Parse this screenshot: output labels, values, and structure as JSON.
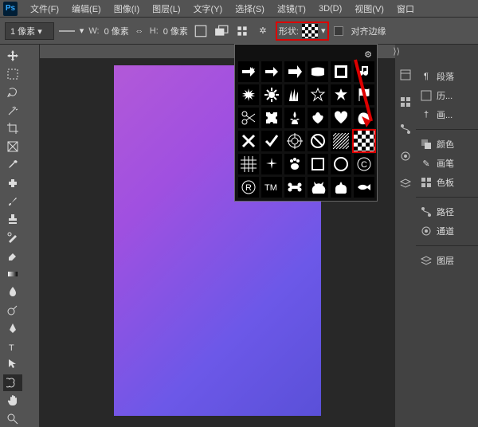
{
  "app": {
    "logo": "Ps"
  },
  "menu": {
    "file": "文件(F)",
    "edit": "编辑(E)",
    "image": "图像(I)",
    "layer": "图层(L)",
    "type": "文字(Y)",
    "select": "选择(S)",
    "filter": "滤镜(T)",
    "threed": "3D(D)",
    "view": "视图(V)",
    "window": "窗口"
  },
  "options": {
    "stroke_width": "1 像素",
    "w_label": "W:",
    "w_value": "0 像素",
    "h_label": "H:",
    "h_value": "0 像素",
    "shape_label": "形状:",
    "align_edges": "对齐边缘"
  },
  "panels": {
    "paragraph": "段落",
    "history": "历...",
    "brush": "画...",
    "color": "颜色",
    "brushes": "画笔",
    "swatches": "色板",
    "paths": "路径",
    "channels": "通道",
    "layers": "图层"
  },
  "shapes_popup": {
    "gear": "⚙"
  }
}
